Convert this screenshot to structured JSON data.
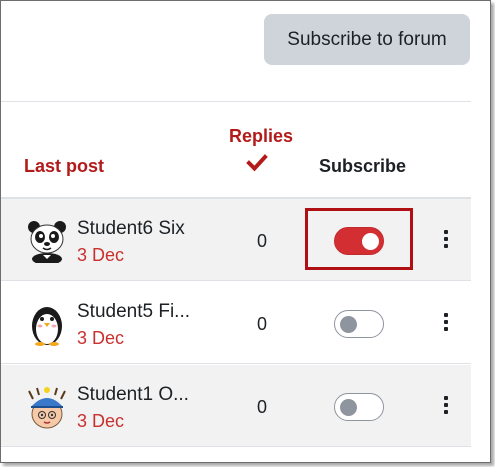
{
  "toolbar": {
    "subscribe_forum_label": "Subscribe to forum"
  },
  "table": {
    "headers": {
      "last_post": "Last post",
      "replies": "Replies",
      "subscribe": "Subscribe"
    },
    "rows": [
      {
        "name": "Student6 Six",
        "date": "3 Dec",
        "replies": "0",
        "subscribed": true,
        "avatar": "panda-avatar-icon"
      },
      {
        "name": "Student5 Fi...",
        "date": "3 Dec",
        "replies": "0",
        "subscribed": false,
        "avatar": "penguin-avatar-icon"
      },
      {
        "name": "Student1 O...",
        "date": "3 Dec",
        "replies": "0",
        "subscribed": false,
        "avatar": "boy-avatar-icon"
      }
    ]
  },
  "colors": {
    "accent": "#b31b1b",
    "toggle_on": "#d32f33",
    "highlight": "#b00f14"
  }
}
